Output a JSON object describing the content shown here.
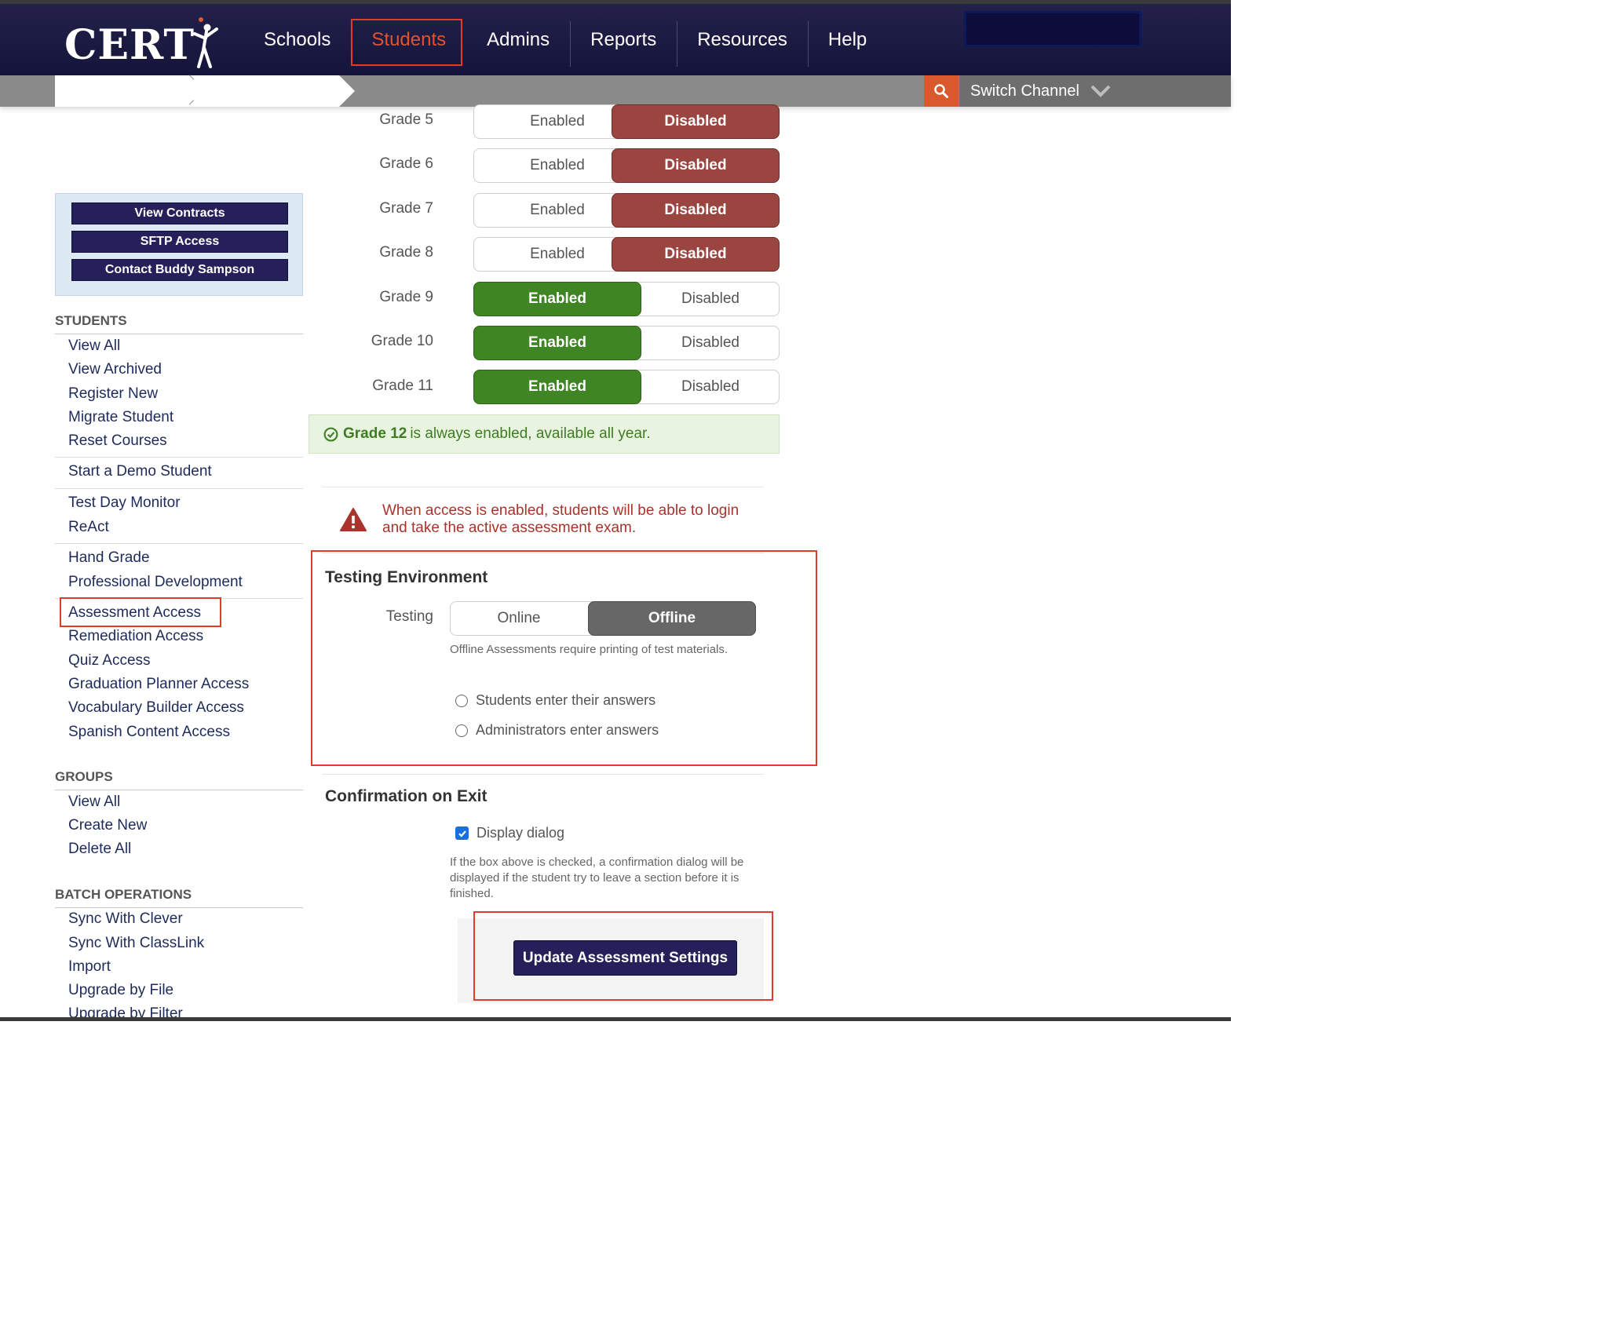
{
  "brand": {
    "logo_text": "CERT"
  },
  "nav": {
    "items": [
      {
        "label": "Schools"
      },
      {
        "label": "Students"
      },
      {
        "label": "Admins"
      },
      {
        "label": "Reports"
      },
      {
        "label": "Resources"
      },
      {
        "label": "Help"
      }
    ],
    "active": "Students"
  },
  "subbar": {
    "switch_channel": "Switch Channel"
  },
  "quick_buttons": [
    "View Contracts",
    "SFTP Access",
    "Contact Buddy Sampson"
  ],
  "sidebar": {
    "students_heading": "STUDENTS",
    "students_links": [
      "View All",
      "View Archived",
      "Register New",
      "Migrate Student",
      "Reset Courses",
      "Start a Demo Student",
      "Test Day Monitor",
      "ReAct",
      "Hand Grade",
      "Professional Development",
      "Assessment Access",
      "Remediation Access",
      "Quiz Access",
      "Graduation Planner Access",
      "Vocabulary Builder Access",
      "Spanish Content Access"
    ],
    "groups_heading": "GROUPS",
    "groups_links": [
      "View All",
      "Create New",
      "Delete All"
    ],
    "batch_heading": "BATCH OPERATIONS",
    "batch_links": [
      "Sync With Clever",
      "Sync With ClassLink",
      "Import",
      "Upgrade by File",
      "Upgrade by Filter"
    ]
  },
  "grades": [
    {
      "label": "Grade 5",
      "state": "Disabled"
    },
    {
      "label": "Grade 6",
      "state": "Disabled"
    },
    {
      "label": "Grade 7",
      "state": "Disabled"
    },
    {
      "label": "Grade 8",
      "state": "Disabled"
    },
    {
      "label": "Grade 9",
      "state": "Enabled"
    },
    {
      "label": "Grade 10",
      "state": "Enabled"
    },
    {
      "label": "Grade 11",
      "state": "Enabled"
    }
  ],
  "toggle_labels": {
    "enabled": "Enabled",
    "disabled": "Disabled"
  },
  "grade12_notice": {
    "strong": "Grade 12",
    "rest": "is always enabled, available all year."
  },
  "warning": "When access is enabled, students will be able to login and take the active assessment exam.",
  "testing_env": {
    "title": "Testing Environment",
    "label": "Testing",
    "online": "Online",
    "offline": "Offline",
    "selected": "Offline",
    "note": "Offline Assessments require printing of test materials.",
    "radio_students": "Students enter their answers",
    "radio_admins": "Administrators enter answers"
  },
  "confirmation": {
    "title": "Confirmation on Exit",
    "checkbox_label": "Display dialog",
    "checked": true,
    "note": "If the box above is checked, a confirmation dialog will be displayed if the student try to leave a section before it is finished."
  },
  "update_button": "Update Assessment Settings",
  "colors": {
    "navy": "#26205a",
    "accent": "#e0542c",
    "disabled_red": "#9a4540",
    "enabled_green": "#3f8523"
  }
}
